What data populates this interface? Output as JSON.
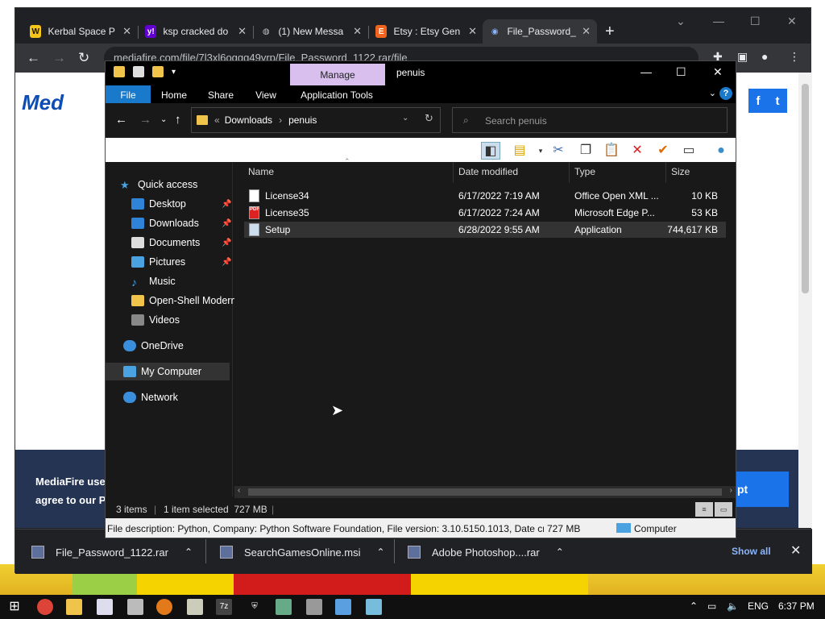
{
  "browser": {
    "tabs": [
      {
        "label": "Kerbal Space P",
        "favicon": "W",
        "favicon_color": "#f5c518",
        "active": false
      },
      {
        "label": "ksp cracked do",
        "favicon": "y!",
        "favicon_color": "#6001d2",
        "active": false
      },
      {
        "label": "(1) New Messa",
        "favicon": "◍",
        "favicon_color": "#5f6368",
        "active": false
      },
      {
        "label": "Etsy : Etsy Gen",
        "favicon": "E",
        "favicon_color": "#f1641e",
        "active": false
      },
      {
        "label": "File_Password_",
        "favicon": "◉",
        "favicon_color": "#1a73e8",
        "active": true
      }
    ],
    "url": "mediafire.com/file/7l3xl6oggg49vrp/File_Password_1122.rar/file",
    "new_tab": "+",
    "page": {
      "logo": "Med",
      "social": [
        "f",
        "t"
      ],
      "cookie_text_line1": "MediaFire uses",
      "cookie_text_line2": "agree to our Pr",
      "accept_label": "pt"
    },
    "downloads": [
      {
        "name": "File_Password_1122.rar"
      },
      {
        "name": "SearchGamesOnline.msi"
      },
      {
        "name": "Adobe Photoshop....rar"
      }
    ],
    "show_all": "Show all"
  },
  "explorer": {
    "title": "penuis",
    "manage_tab": "Manage",
    "ribbon_tabs": [
      "File",
      "Home",
      "Share",
      "View",
      "Application Tools"
    ],
    "breadcrumb": [
      "Downloads",
      "penuis"
    ],
    "search_placeholder": "Search penuis",
    "nav": {
      "quick_access": "Quick access",
      "items": [
        {
          "label": "Desktop",
          "pinned": true,
          "icon_color": "#2f84d8"
        },
        {
          "label": "Downloads",
          "pinned": true,
          "icon_color": "#2f84d8"
        },
        {
          "label": "Documents",
          "pinned": true,
          "icon_color": "#dddddd"
        },
        {
          "label": "Pictures",
          "pinned": true,
          "icon_color": "#4aa3e0"
        },
        {
          "label": "Music",
          "pinned": false,
          "icon_color": "#4aa3e0"
        },
        {
          "label": "Open-Shell Modern",
          "pinned": false,
          "icon_color": "#f0c34a"
        },
        {
          "label": "Videos",
          "pinned": false,
          "icon_color": "#888888"
        }
      ],
      "onedrive": "OneDrive",
      "computer": "My Computer",
      "network": "Network"
    },
    "columns": [
      "Name",
      "Date modified",
      "Type",
      "Size"
    ],
    "files": [
      {
        "name": "License34",
        "date": "6/17/2022 7:19 AM",
        "type": "Office Open XML ...",
        "size": "10 KB",
        "icon": "doc",
        "selected": false
      },
      {
        "name": "License35",
        "date": "6/17/2022 7:24 AM",
        "type": "Microsoft Edge P...",
        "size": "53 KB",
        "icon": "pdf",
        "selected": false
      },
      {
        "name": "Setup",
        "date": "6/28/2022 9:55 AM",
        "type": "Application",
        "size": "744,617 KB",
        "icon": "exe",
        "selected": true
      }
    ],
    "status": {
      "items": "3 items",
      "selected": "1 item selected  727 MB"
    },
    "description": "File description: Python, Company: Python Software Foundation, File version: 3.10.5150.1013, Date creat",
    "desc_size": "727 MB",
    "desc_location": "Computer"
  },
  "taskbar": {
    "lang": "ENG",
    "time": "6:37 PM"
  },
  "colors": {
    "accent": "#1979ca",
    "manage": "#d8bfee"
  }
}
